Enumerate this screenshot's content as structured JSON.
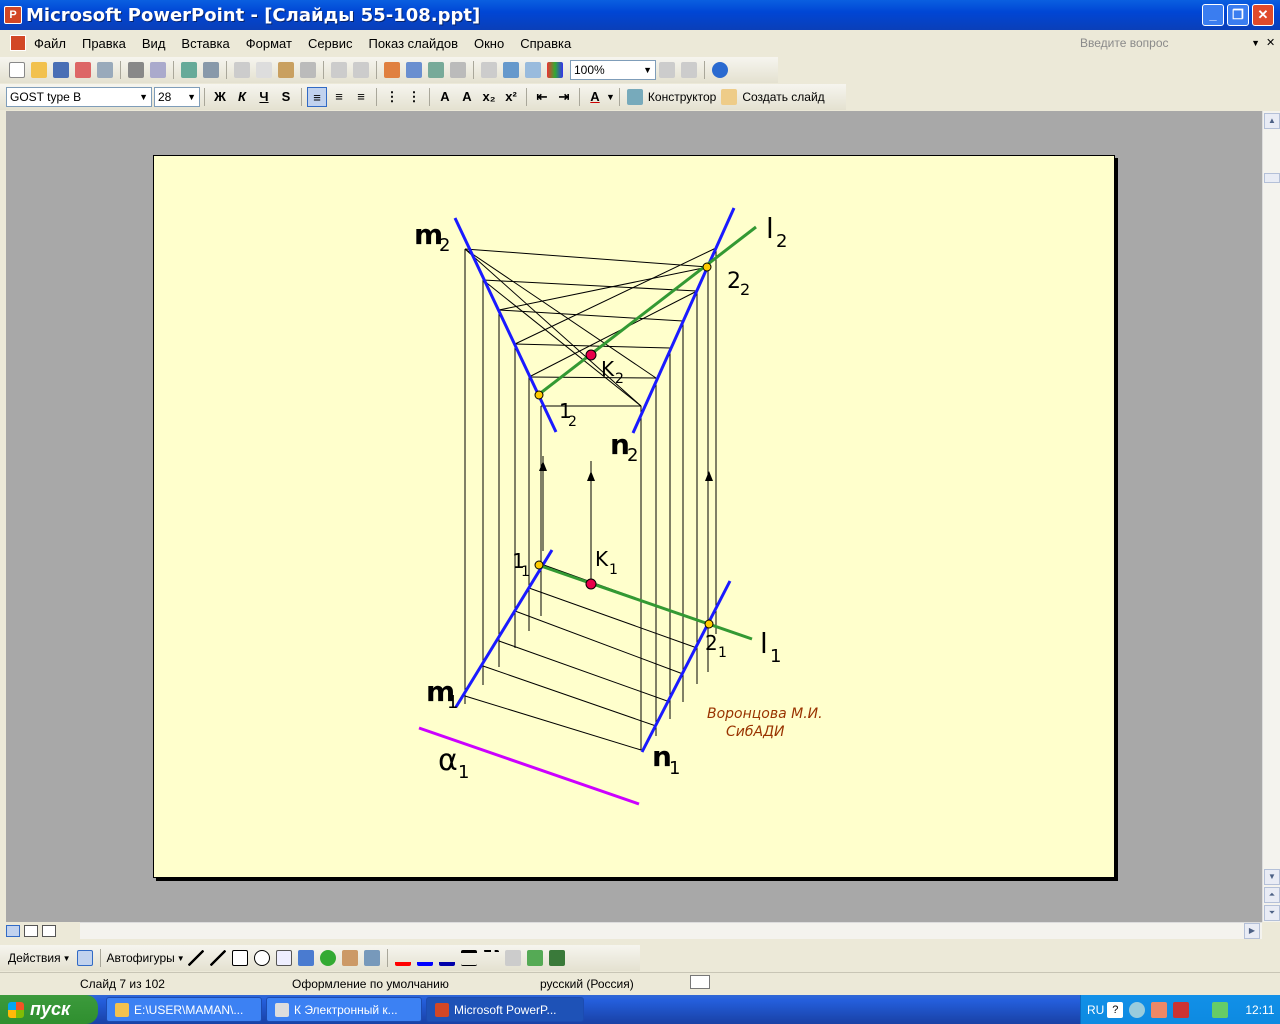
{
  "window": {
    "title": "Microsoft PowerPoint - [Слайды 55-108.ppt]",
    "minimize_label": "_",
    "maximize_label": "❐",
    "close_label": "✕"
  },
  "menu": {
    "items": [
      "Файл",
      "Правка",
      "Вид",
      "Вставка",
      "Формат",
      "Сервис",
      "Показ слайдов",
      "Окно",
      "Справка"
    ],
    "help_placeholder": "Введите вопрос",
    "close_doc_label": "✕"
  },
  "toolbar": {
    "zoom": "100%"
  },
  "format_toolbar": {
    "font": "GOST type B",
    "size": "28",
    "bold": "Ж",
    "italic": "К",
    "underline": "Ч",
    "shadow": "S",
    "designer_label": "Конструктор",
    "new_slide_label": "Создать слайд"
  },
  "slide": {
    "labels": {
      "m2": "m",
      "m2_sub": "2",
      "l2": "l",
      "l2_sub": "2",
      "p22": "2",
      "p22_sub": "2",
      "k2": "K",
      "k2_sub": "2",
      "p12": "1",
      "p12_sub": "2",
      "n2": "n",
      "n2_sub": "2",
      "k1": "K",
      "k1_sub": "1",
      "p11": "1",
      "p11_sub": "1",
      "p21": "2",
      "p21_sub": "1",
      "l1": "l",
      "l1_sub": "1",
      "m1": "m",
      "m1_sub": "1",
      "n1": "n",
      "n1_sub": "1",
      "alpha1": "α",
      "alpha1_sub": "1"
    },
    "author": "Воронцова М.И.",
    "institute": "СибАДИ",
    "colors": {
      "background": "#ffffcc",
      "edge_lines": "#1a1aff",
      "line_l": "#339933",
      "plane_alpha": "#cc00ff",
      "point_k": "#e8004a",
      "point_yellow": "#ffcc00",
      "author_text": "#993300"
    }
  },
  "drawing_toolbar": {
    "actions_label": "Действия",
    "autoshapes_label": "Автофигуры"
  },
  "status": {
    "slide_info": "Слайд 7 из 102",
    "design": "Оформление по умолчанию",
    "language": "русский (Россия)"
  },
  "taskbar": {
    "start_label": "пуск",
    "tasks": [
      "E:\\USER\\MAMAN\\...",
      "К Электронный к...",
      "Microsoft PowerP..."
    ],
    "lang": "RU",
    "clock": "12:11"
  }
}
